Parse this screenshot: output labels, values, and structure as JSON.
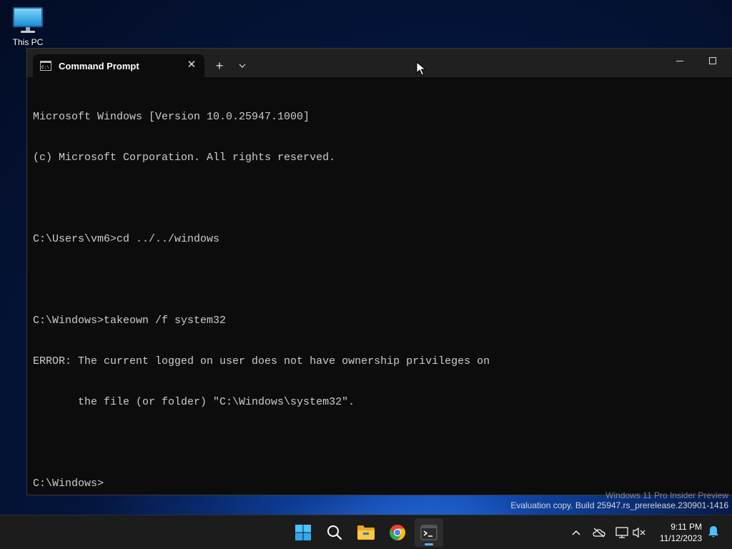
{
  "desktop": {
    "icons": [
      {
        "label": "This PC",
        "icon": "monitor-icon"
      }
    ]
  },
  "window": {
    "tab": {
      "title": "Command Prompt",
      "icon": "cmd-icon"
    },
    "new_tab_symbol": "+",
    "dropdown_symbol": "⌄",
    "minimize_symbol": "—",
    "maximize_symbol": "☐",
    "close_symbol": "✕",
    "console_lines": [
      "Microsoft Windows [Version 10.0.25947.1000]",
      "(c) Microsoft Corporation. All rights reserved.",
      "",
      "C:\\Users\\vm6>cd ../../windows",
      "",
      "C:\\Windows>takeown /f system32",
      "ERROR: The current logged on user does not have ownership privileges on",
      "       the file (or folder) \"C:\\Windows\\system32\".",
      "",
      "C:\\Windows>"
    ]
  },
  "watermark": {
    "line1": "Windows 11 Pro Insider Preview",
    "line2": "Evaluation copy. Build 25947.rs_prerelease.230901-1416"
  },
  "taskbar": {
    "apps": [
      {
        "name": "start",
        "icon": "windows-logo-icon"
      },
      {
        "name": "search",
        "icon": "search-icon"
      },
      {
        "name": "file-explorer",
        "icon": "folder-icon"
      },
      {
        "name": "chrome",
        "icon": "chrome-icon"
      },
      {
        "name": "terminal",
        "icon": "terminal-icon",
        "active": true
      }
    ],
    "tray": [
      "chevron-up-icon",
      "onedrive-offline-icon",
      "network-icon",
      "volume-muted-icon"
    ],
    "clock": {
      "time": "9:11 PM",
      "date": "11/12/2023"
    },
    "notification_icon": "bell-icon"
  },
  "colors": {
    "console_bg": "#0c0c0c",
    "console_fg": "#cccccc",
    "titlebar_bg": "#202020",
    "taskbar_bg": "#1c1c1c",
    "active_indicator": "#5fb2f2"
  }
}
